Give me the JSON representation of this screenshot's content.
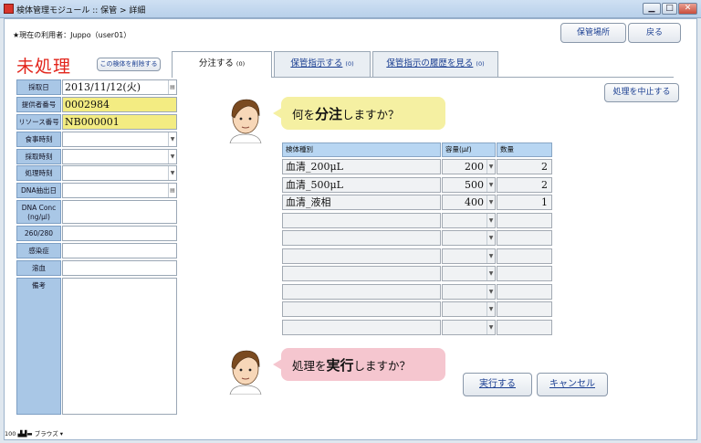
{
  "window": {
    "title": "検体管理モジュール :: 保管 > 詳細",
    "min": "▁",
    "max": "□",
    "close": "✕"
  },
  "header": {
    "user_line": "★現在の利用者：Juppo（user01）",
    "storage_place_button": "保管場所",
    "back_button": "戻る"
  },
  "status": {
    "title": "未処理",
    "delete_button": "この検体を削除する"
  },
  "form": {
    "fields": [
      {
        "label": "採取日",
        "value": "2013/11/12(火)",
        "control": "calendar"
      },
      {
        "label": "提供者番号",
        "value": "0002984",
        "highlight": true
      },
      {
        "label": "リソース番号",
        "value": "NB000001",
        "highlight": true
      },
      {
        "label": "食事時刻",
        "value": "",
        "control": "dropdown"
      },
      {
        "label": "採取時刻",
        "value": "",
        "control": "dropdown"
      },
      {
        "label": "処理時刻",
        "value": "",
        "control": "dropdown"
      },
      {
        "label": "DNA抽出日",
        "value": "",
        "control": "calendar"
      },
      {
        "label": "DNA Conc (ng/μl)",
        "value": ""
      },
      {
        "label": "260/280",
        "value": ""
      },
      {
        "label": "感染症",
        "value": ""
      },
      {
        "label": "溶血",
        "value": ""
      },
      {
        "label": "備考",
        "value": ""
      }
    ]
  },
  "tabs": [
    {
      "label": "分注する",
      "count": "(0)",
      "active": true
    },
    {
      "label": "保管指示する",
      "count": "(0)",
      "active": false
    },
    {
      "label": "保管指示の履歴を見る",
      "count": "(0)",
      "active": false
    }
  ],
  "main": {
    "cancel_process_button": "処理を中止する",
    "question1": {
      "pre": "何を",
      "bold": "分注",
      "post": "しますか？"
    },
    "question2": {
      "pre": "処理を",
      "bold": "実行",
      "post": "しますか？"
    },
    "table": {
      "columns": [
        "検体種別",
        "容量(μℓ)",
        "数量"
      ],
      "rows": [
        {
          "type": "血清_200μL",
          "volume": "200",
          "qty": "2"
        },
        {
          "type": "血清_500μL",
          "volume": "500",
          "qty": "2"
        },
        {
          "type": "血清_液相",
          "volume": "400",
          "qty": "1"
        },
        {
          "type": "",
          "volume": "",
          "qty": ""
        },
        {
          "type": "",
          "volume": "",
          "qty": ""
        },
        {
          "type": "",
          "volume": "",
          "qty": ""
        },
        {
          "type": "",
          "volume": "",
          "qty": ""
        },
        {
          "type": "",
          "volume": "",
          "qty": ""
        },
        {
          "type": "",
          "volume": "",
          "qty": ""
        },
        {
          "type": "",
          "volume": "",
          "qty": ""
        }
      ]
    },
    "execute_button": "実行する",
    "cancel_button": "キャンセル"
  },
  "footer": {
    "zoom": "100",
    "mode": "ブラウズ"
  },
  "colors": {
    "status_red": "#e2241b",
    "label_blue": "#a9c7e6",
    "highlight_yellow": "#f3ec82",
    "link_blue": "#1b3f92"
  }
}
